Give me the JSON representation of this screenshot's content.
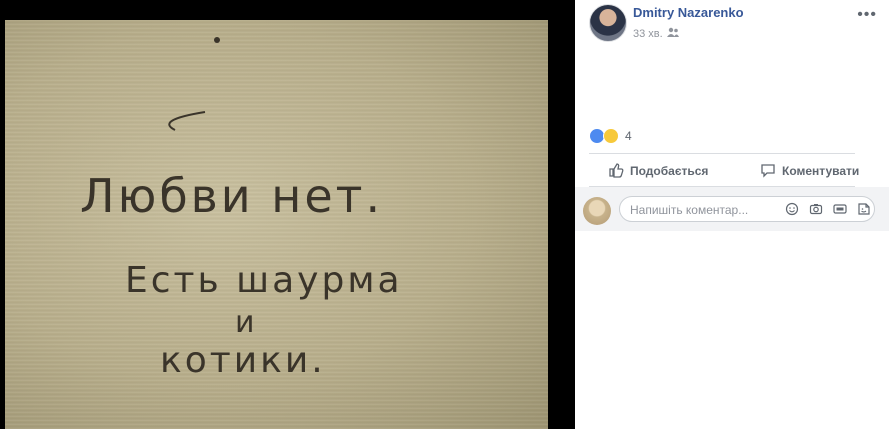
{
  "post": {
    "author": "Dmitry Nazarenko",
    "time": "33 хв.",
    "photo_text": [
      "Любви нет.",
      "Есть шаурма",
      "и",
      "котики."
    ],
    "reactions_count": "4"
  },
  "actions": {
    "like_label": "Подобається",
    "comment_label": "Коментувати"
  },
  "comment": {
    "placeholder": "Напишіть коментар..."
  },
  "colors": {
    "author_link": "#385898",
    "meta": "#90949c",
    "action_text": "#606770"
  }
}
